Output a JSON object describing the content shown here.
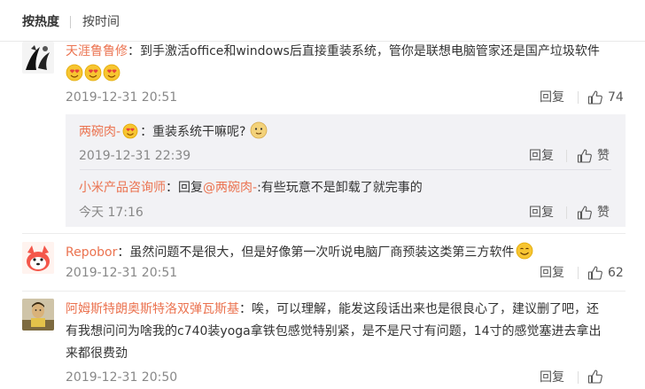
{
  "sort": {
    "hot_label": "按热度",
    "time_label": "按时间"
  },
  "comments": [
    {
      "username": "天涯鲁鲁修",
      "text": "：到手激活office和windows后直接重装系统，管你是联想电脑管家还是国产垃圾软件",
      "time": "2019-12-31 20:51",
      "reply_label": "回复",
      "likes": "74"
    },
    {
      "username": "Repobor",
      "text": "：虽然问题不是很大，但是好像第一次听说电脑厂商预装这类第三方软件",
      "time": "2019-12-31 20:51",
      "reply_label": "回复",
      "likes": "62"
    },
    {
      "username": "阿姆斯特朗奥斯特洛双弹瓦斯基",
      "text_line1": "：唉，可以理解，能发这段话出来也是很良心了，建议删了吧，还",
      "text_line2": "有我想问问为啥我的c740装yoga拿铁包感觉特别紧，是不是尺寸有问题，14寸的感觉塞进去拿出",
      "text_line3": "来都很费劲",
      "time": "2019-12-31 20:50",
      "reply_label": "回复"
    }
  ],
  "replies": [
    {
      "username": "两碗肉-",
      "text": "：重装系统干嘛呢?",
      "time": "2019-12-31 22:39",
      "reply_label": "回复",
      "like_label": "赞"
    },
    {
      "username": "小米产品咨询师",
      "reply_prefix": "：回复",
      "mention": "@两碗肉-",
      "text": ":有些玩意不是卸载了就完事的",
      "time": "今天 17:16",
      "reply_label": "回复",
      "like_label": "赞"
    }
  ],
  "colors": {
    "username": "#eb7350",
    "link": "#eb7350",
    "muted": "#888888",
    "reply_bg": "#f2f2f5"
  }
}
